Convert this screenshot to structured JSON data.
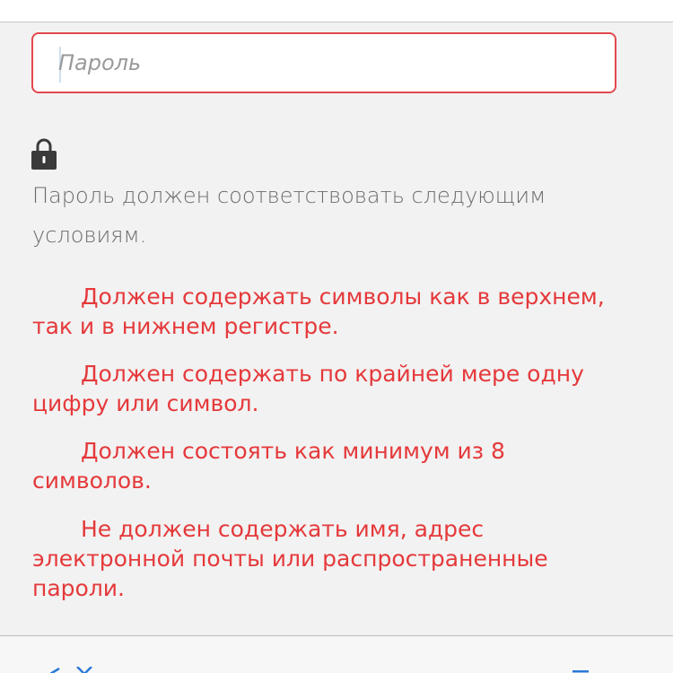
{
  "password_field": {
    "placeholder": "Пароль",
    "value": ""
  },
  "requirements": {
    "intro": "Пароль должен соответствовать следующим условиям.",
    "rules": [
      "Должен содержать символы как в верхнем, так и в нижнем регистре.",
      "Должен содержать по крайней мере одну цифру или символ.",
      "Должен состоять как минимум из 8 символов.",
      "Не должен содержать имя, адрес электронной почты или распространенные пароли."
    ]
  },
  "colors": {
    "error": "#e5393b",
    "field_border": "#e2484d",
    "intro_text": "#6b6b6b",
    "icon_dark": "#3a3a3a",
    "bottom_icon": "#2a7ad6"
  },
  "icons": {
    "lock": "lock-icon",
    "bottom_left": "close-icon",
    "bottom_right": "menu-icon"
  }
}
